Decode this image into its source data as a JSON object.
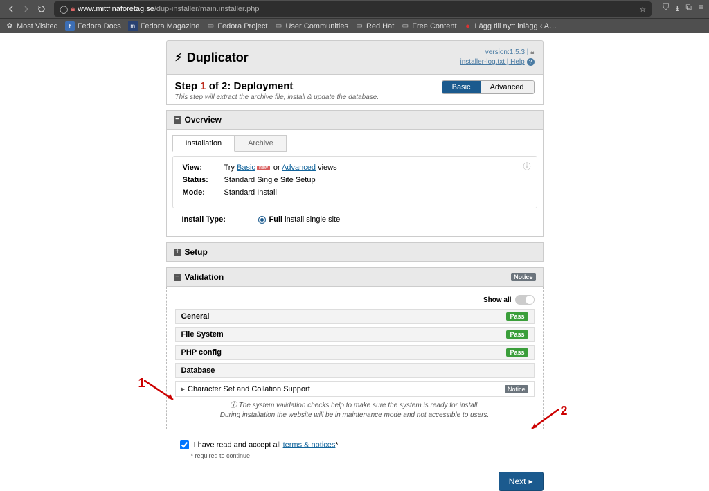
{
  "browser": {
    "url_domain": "www.mittfinaforetag.se",
    "url_path": "/dup-installer/main.installer.php"
  },
  "bookmarks": [
    "Most Visited",
    "Fedora Docs",
    "Fedora Magazine",
    "Fedora Project",
    "User Communities",
    "Red Hat",
    "Free Content",
    "Lägg till nytt inlägg ‹ A…"
  ],
  "header": {
    "title": "Duplicator",
    "version": "version:1.5.3 |",
    "links": "installer-log.txt  |  Help"
  },
  "step": {
    "title_pre": "Step ",
    "num": "1",
    "title_post": " of 2: Deployment",
    "desc": "This step will extract the archive file, install & update the database.",
    "mode_basic": "Basic",
    "mode_advanced": "Advanced"
  },
  "sections": {
    "overview": "Overview",
    "setup": "Setup",
    "validation": "Validation",
    "notice": "Notice"
  },
  "tabs": {
    "installation": "Installation",
    "archive": "Archive"
  },
  "info": {
    "view_label": "View:",
    "view_val_pre": "Try ",
    "view_basic": "Basic",
    "view_new": "new",
    "view_or": " or ",
    "view_adv": "Advanced",
    "view_post": " views",
    "status_label": "Status:",
    "status_val": "Standard Single Site Setup",
    "mode_label": "Mode:",
    "mode_val": "Standard Install"
  },
  "install_type": {
    "label": "Install Type:",
    "opt_bold": "Full",
    "opt_rest": " install single site"
  },
  "validation": {
    "showall": "Show all",
    "rows": [
      {
        "label": "General",
        "badge": "Pass"
      },
      {
        "label": "File System",
        "badge": "Pass"
      },
      {
        "label": "PHP config",
        "badge": "Pass"
      }
    ],
    "db_label": "Database",
    "db_sub": "Character Set and Collation Support",
    "db_badge": "Notice",
    "note1": "The system validation checks help to make sure the system is ready for install.",
    "note2": "During installation the website will be in maintenance mode and not accessible to users."
  },
  "terms": {
    "text_pre": "I have read and accept all ",
    "link": "terms & notices",
    "star": "*",
    "sub": "* required to continue"
  },
  "buttons": {
    "next": "Next"
  },
  "annotations": {
    "one": "1",
    "two": "2"
  }
}
